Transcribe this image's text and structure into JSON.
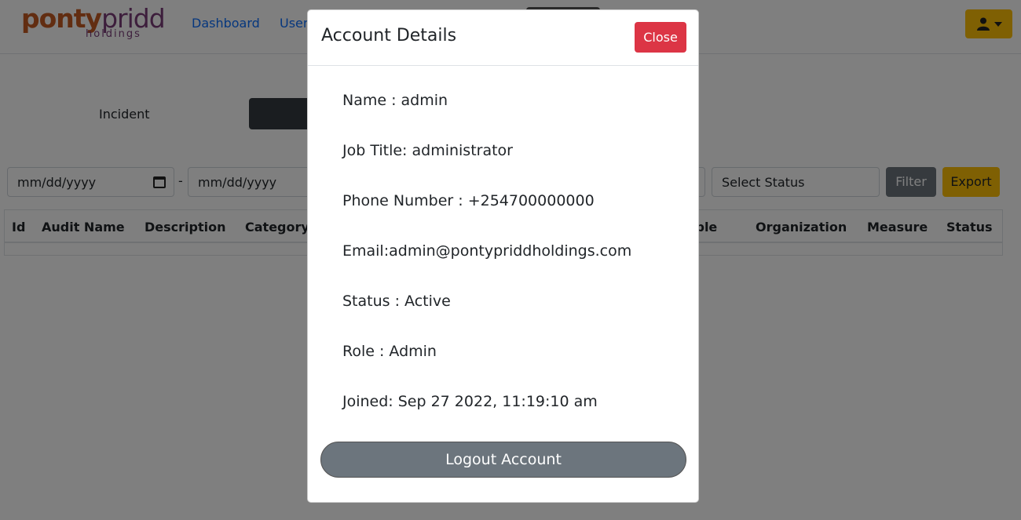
{
  "logo": {
    "brand_word_1": "ponty",
    "brand_word_2": "pridd",
    "brand_sub": "holdings"
  },
  "nav": {
    "dashboard": "Dashboard",
    "users": "Users"
  },
  "user_menu": {
    "icon": "user-icon"
  },
  "page": {
    "incident_label": "Incident"
  },
  "filters": {
    "date_from_placeholder": "mm/dd/yyyy",
    "date_to_placeholder": "mm/dd/yyyy",
    "separator": "-",
    "status_placeholder": "Select Status",
    "filter_label": "Filter",
    "export_label": "Export"
  },
  "table": {
    "headers": [
      "Id",
      "Audit Name",
      "Description",
      "Category",
      "ible",
      "Organization",
      "Measure",
      "Status"
    ]
  },
  "modal": {
    "title": "Account Details",
    "close_label": "Close",
    "details": [
      "Name : admin",
      "Job Title: administrator",
      "Phone Number : +254700000000",
      "Email:admin@pontypriddholdings.com",
      "Status : Active",
      "Role : Admin",
      "Joined: Sep 27 2022, 11:19:10 am"
    ],
    "logout_label": "Logout Account"
  },
  "colors": {
    "primary_link": "#0d6efd",
    "warning": "#ffc107",
    "danger": "#dc3545",
    "secondary": "#6c757d",
    "dark": "#343a40"
  }
}
